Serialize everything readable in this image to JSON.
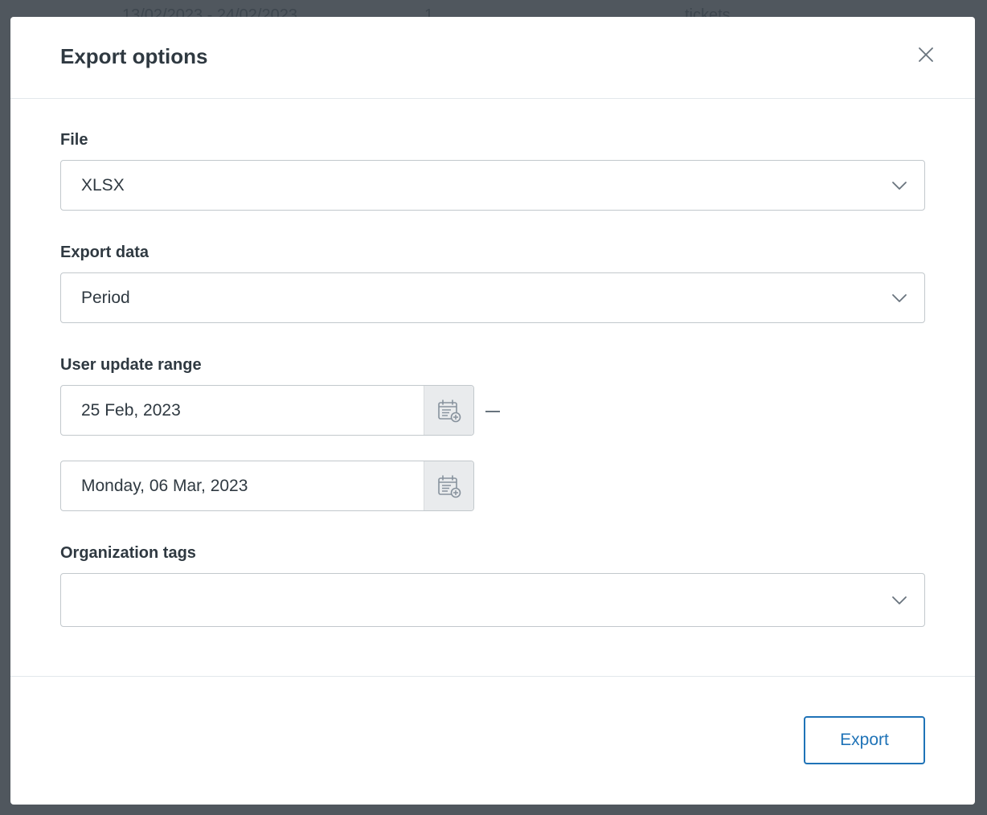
{
  "background": {
    "row_cells": [
      "13/02/2023 - 24/02/2023",
      "1",
      "tickets"
    ]
  },
  "modal": {
    "title": "Export options",
    "close_icon": "close-icon"
  },
  "file": {
    "label": "File",
    "value": "XLSX"
  },
  "export_data": {
    "label": "Export data",
    "value": "Period"
  },
  "user_update_range": {
    "label": "User update range",
    "start_date": "25 Feb, 2023",
    "end_date": "Monday, 06 Mar, 2023",
    "separator": "—",
    "calendar_icon": "calendar-add-icon"
  },
  "organization_tags": {
    "label": "Organization tags",
    "value": ""
  },
  "footer": {
    "export_label": "Export"
  },
  "colors": {
    "overlay": "#50575e",
    "text": "#2f3941",
    "border": "#c2c8cc",
    "accent": "#1f73b7",
    "calendar_button_bg": "#e9ebed"
  }
}
